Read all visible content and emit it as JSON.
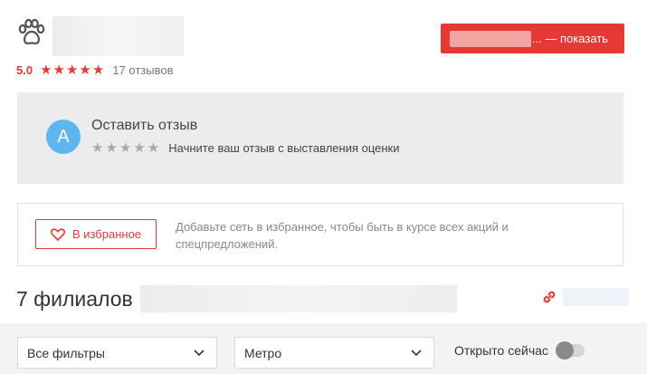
{
  "header": {
    "rating_value": "5.0",
    "rating_stars": "★★★★★",
    "review_count": "17 отзывов",
    "phone_button_label": "... — показать",
    "accent_color": "#e53935"
  },
  "review_prompt": {
    "avatar_letter": "А",
    "title": "Оставить отзыв",
    "empty_stars": "★★★★★",
    "hint": "Начните ваш отзыв с выставления оценки",
    "avatar_color": "#5eb6ee"
  },
  "favorites": {
    "button_label": "В избранное",
    "description": "Добавьте сеть в избранное, чтобы быть в курсе всех акций и спецпредложений."
  },
  "branches": {
    "title": "7 филиалов"
  },
  "filters": {
    "all_filters_label": "Все фильтры",
    "metro_label": "Метро",
    "open_now_label": "Открыто сейчас",
    "open_now_enabled": false
  },
  "icons": {
    "logo": "paw-icon",
    "favorite": "heart-icon",
    "share": "link-icon",
    "dropdown": "chevron-down-icon"
  }
}
